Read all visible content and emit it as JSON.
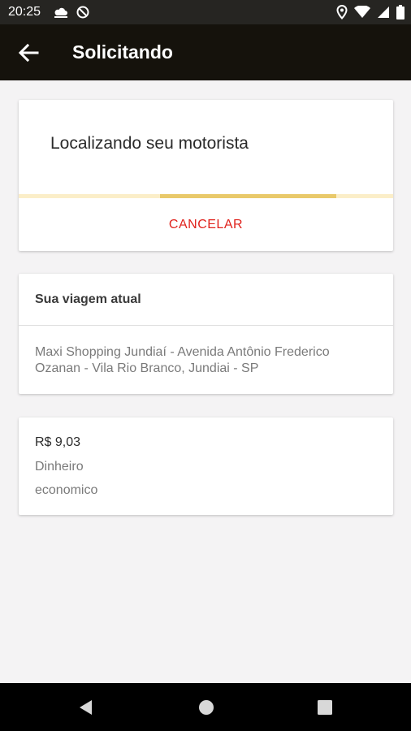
{
  "status_bar": {
    "time": "20:25",
    "icons": [
      "cloud-icon",
      "blocked-icon",
      "location-icon",
      "wifi-icon",
      "signal-icon",
      "battery-icon"
    ]
  },
  "app_bar": {
    "back_icon": "arrow-left-icon",
    "title": "Solicitando"
  },
  "searching_card": {
    "message": "Localizando seu motorista",
    "cancel_label": "CANCELAR",
    "progress_color": "#e9c96a",
    "track_color": "#fbeec8",
    "cancel_color": "#e0221c"
  },
  "trip_card": {
    "header": "Sua viagem atual",
    "address": "Maxi Shopping Jundiaí - Avenida Antônio Frederico Ozanan - Vila Rio Branco, Jundiai - SP"
  },
  "fare_card": {
    "price": "R$ 9,03",
    "payment": "Dinheiro",
    "category": "economico"
  },
  "nav_bar": {
    "icons": [
      "back-triangle-icon",
      "home-circle-icon",
      "recents-square-icon"
    ]
  }
}
